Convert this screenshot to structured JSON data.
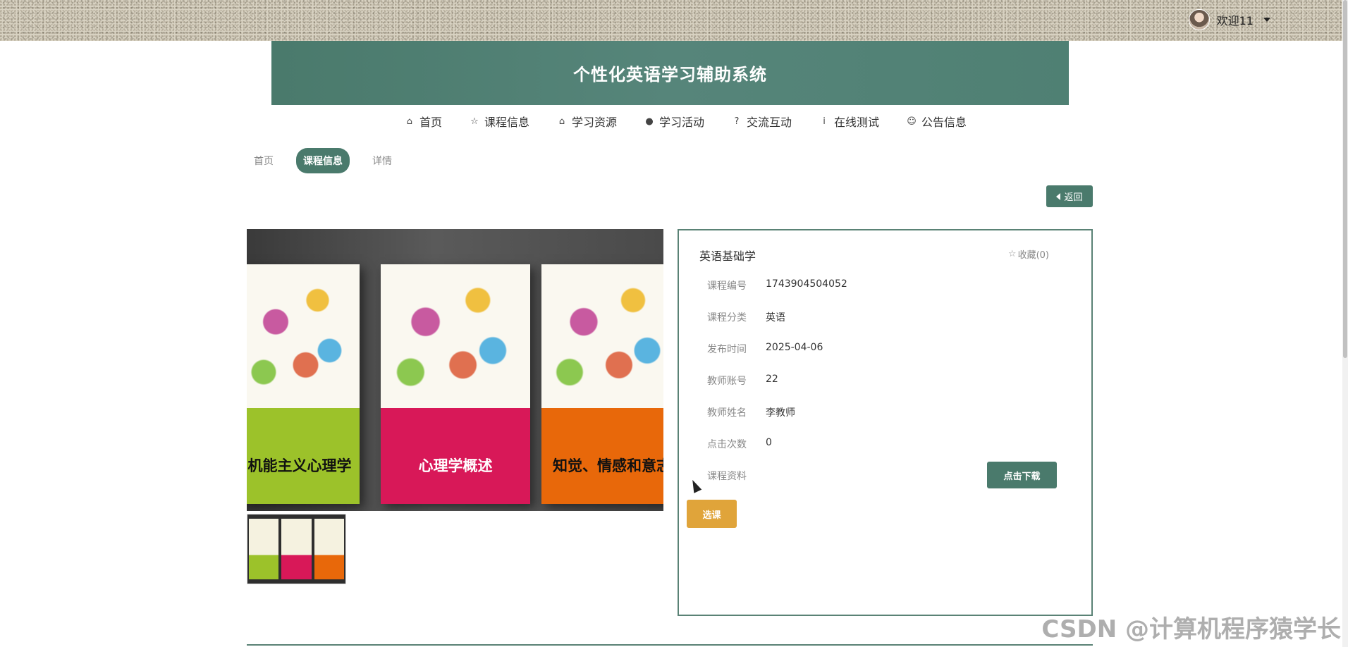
{
  "topbar": {
    "welcome": "欢迎11"
  },
  "header": {
    "title": "个性化英语学习辅助系统"
  },
  "nav": [
    {
      "label": "首页",
      "icon": "⌂"
    },
    {
      "label": "课程信息",
      "icon": "☆"
    },
    {
      "label": "学习资源",
      "icon": "⌂"
    },
    {
      "label": "学习活动",
      "icon": "●"
    },
    {
      "label": "交流互动",
      "icon": "?"
    },
    {
      "label": "在线测试",
      "icon": "i"
    },
    {
      "label": "公告信息",
      "icon": "☺"
    }
  ],
  "breadcrumb": {
    "home": "首页",
    "current": "课程信息",
    "detail": "详情"
  },
  "back_label": "返回",
  "books": [
    {
      "title": "机能主义心理学"
    },
    {
      "title": "心理学概述"
    },
    {
      "title": "知觉、情感和意志"
    }
  ],
  "course": {
    "title": "英语基础学",
    "favorite": "收藏(0)",
    "fields": [
      {
        "label": "课程编号",
        "value": "1743904504052"
      },
      {
        "label": "课程分类",
        "value": "英语"
      },
      {
        "label": "发布时间",
        "value": "2025-04-06"
      },
      {
        "label": "教师账号",
        "value": "22"
      },
      {
        "label": "教师姓名",
        "value": "李教师"
      },
      {
        "label": "点击次数",
        "value": "0"
      },
      {
        "label": "课程资料",
        "value": ""
      }
    ],
    "download_label": "点击下载",
    "select_label": "选课"
  },
  "watermark": "CSDN @计算机程序猿学长"
}
